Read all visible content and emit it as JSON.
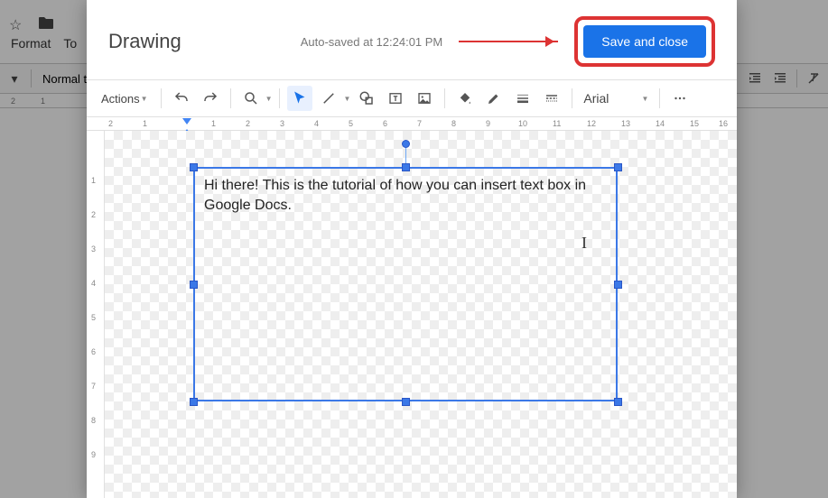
{
  "docs_bg": {
    "menu_format": "Format",
    "menu_tools_label_partial": "To",
    "style_select": "Normal text",
    "ruler_ticks": [
      "2",
      "1"
    ]
  },
  "dialog": {
    "title": "Drawing",
    "autosave": "Auto-saved at 12:24:01 PM",
    "save_button": "Save and close",
    "toolbar": {
      "actions": "Actions",
      "font": "Arial"
    },
    "h_ruler": [
      "2",
      "1",
      "",
      "1",
      "2",
      "3",
      "4",
      "5",
      "6",
      "7",
      "8",
      "9",
      "10",
      "11",
      "12",
      "13",
      "14",
      "15",
      "16"
    ],
    "v_ruler": [
      "",
      "1",
      "2",
      "3",
      "4",
      "5",
      "6",
      "7",
      "8",
      "9"
    ],
    "textbox_content": "Hi there! This is the tutorial of how you can insert text box in Google Docs."
  }
}
